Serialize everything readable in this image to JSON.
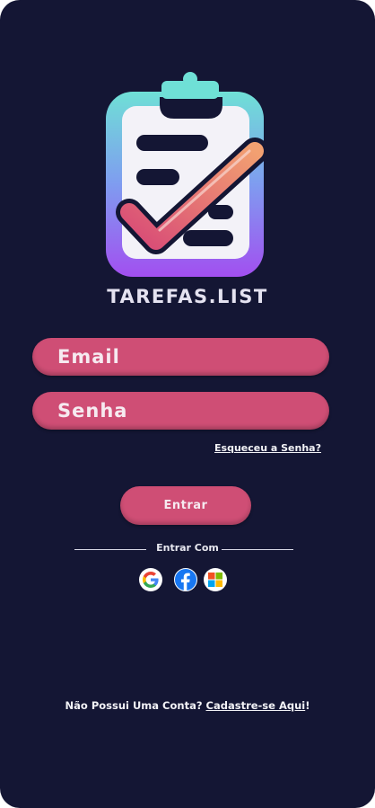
{
  "app": {
    "title": "TAREFAS.LIST"
  },
  "form": {
    "email_placeholder": "Email",
    "password_placeholder": "Senha",
    "forgot_password": "Esqueceu a Senha?",
    "submit_label": "Entrar"
  },
  "social": {
    "divider_label": "Entrar Com",
    "providers": [
      {
        "name": "google",
        "icon": "google-icon"
      },
      {
        "name": "facebook",
        "icon": "facebook-icon"
      },
      {
        "name": "microsoft",
        "icon": "microsoft-icon"
      }
    ]
  },
  "footer": {
    "prompt": "Não Possui Uma Conta? ",
    "signup_link": "Cadastre-se Aqui",
    "suffix": "!"
  },
  "colors": {
    "background": "#141634",
    "accent": "#cf4e75",
    "text": "#f2f2f6"
  }
}
